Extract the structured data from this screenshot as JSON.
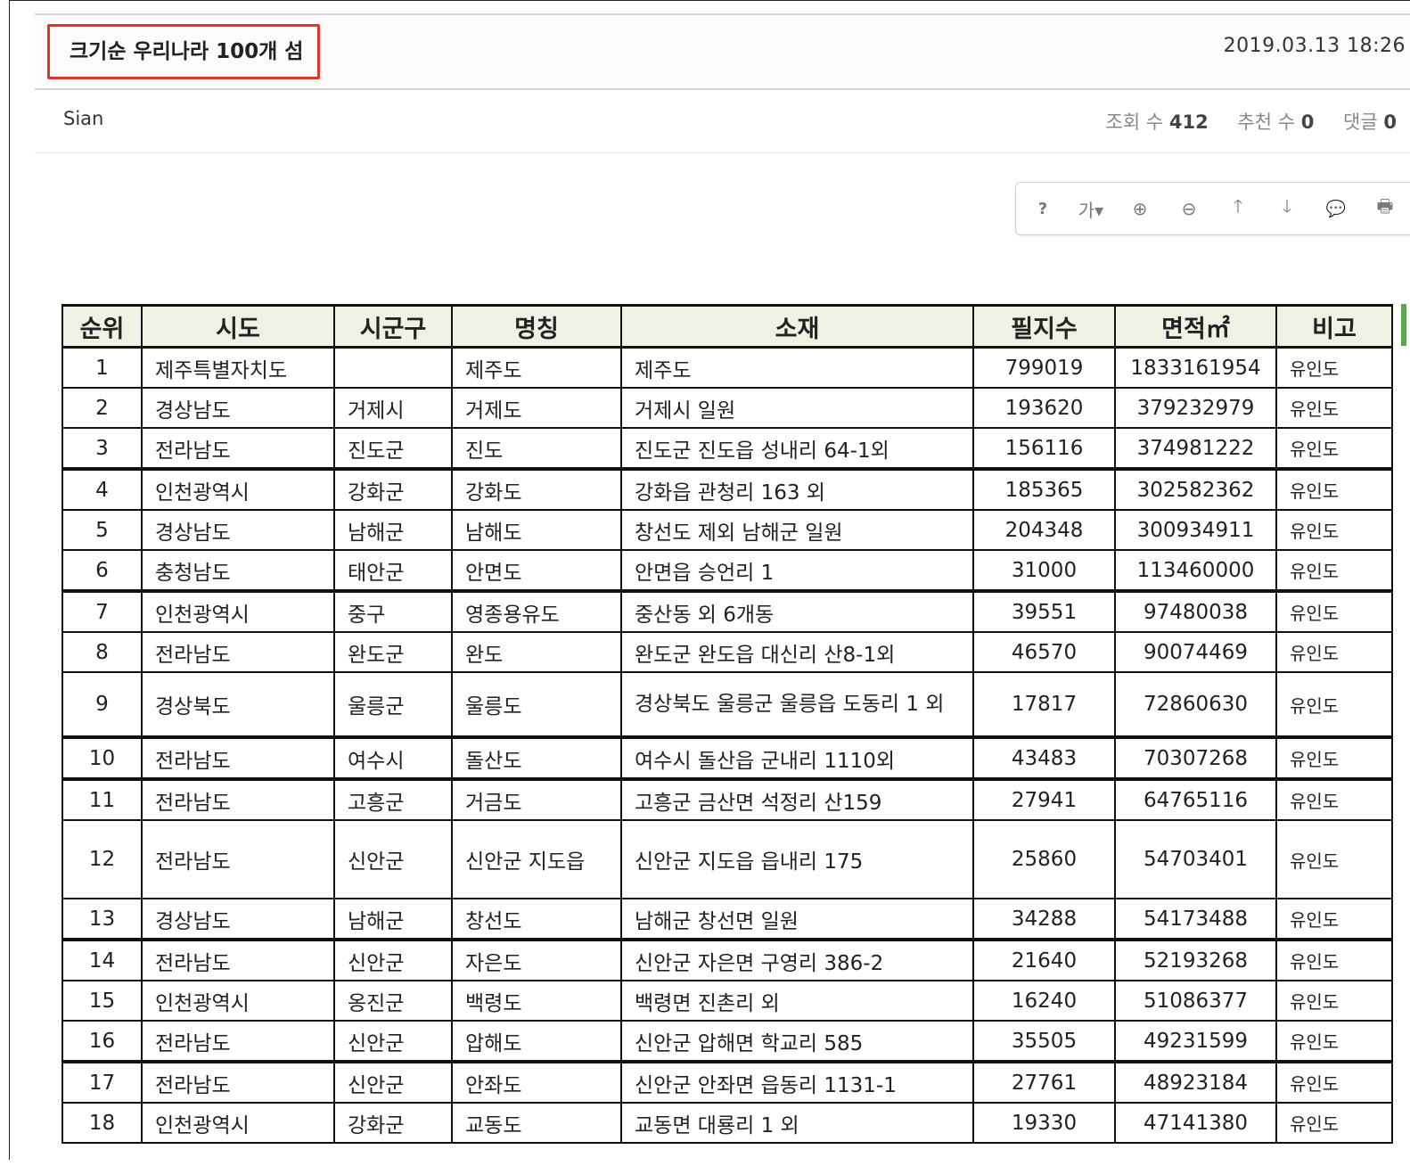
{
  "post": {
    "title": "크기순 우리나라 100개 섬",
    "date": "2019.03.13 18:26",
    "author": "Sian",
    "stats": [
      {
        "label": "조회 수",
        "value": "412"
      },
      {
        "label": "추천 수",
        "value": "0"
      },
      {
        "label": "댓글",
        "value": "0"
      }
    ]
  },
  "toolbar": {
    "buttons": [
      {
        "name": "help-icon",
        "glyph": "?"
      },
      {
        "name": "font-size-icon",
        "glyph": "가▾"
      },
      {
        "name": "zoom-in-icon",
        "glyph": "⊕"
      },
      {
        "name": "zoom-out-icon",
        "glyph": "⊖"
      },
      {
        "name": "arrow-up-icon",
        "glyph": "🡑"
      },
      {
        "name": "arrow-down-icon",
        "glyph": "🡓"
      },
      {
        "name": "comment-icon",
        "glyph": "💬"
      },
      {
        "name": "print-icon",
        "glyph": "🖶"
      }
    ]
  },
  "table": {
    "headers": [
      "순위",
      "시도",
      "시군구",
      "명칭",
      "소재",
      "필지수",
      "면적㎡",
      "비고"
    ],
    "rows": [
      [
        "1",
        "제주특별자치도",
        "",
        "제주도",
        "제주도",
        "799019",
        "1833161954",
        "유인도"
      ],
      [
        "2",
        "경상남도",
        "거제시",
        "거제도",
        "거제시 일원",
        "193620",
        "379232979",
        "유인도"
      ],
      [
        "3",
        "전라남도",
        "진도군",
        "진도",
        "진도군 진도읍 성내리 64-1외",
        "156116",
        "374981222",
        "유인도"
      ],
      [
        "4",
        "인천광역시",
        "강화군",
        "강화도",
        "강화읍 관청리 163 외",
        "185365",
        "302582362",
        "유인도"
      ],
      [
        "5",
        "경상남도",
        "남해군",
        "남해도",
        "창선도 제외 남해군 일원",
        "204348",
        "300934911",
        "유인도"
      ],
      [
        "6",
        "충청남도",
        "태안군",
        "안면도",
        "안면읍 승언리 1",
        "31000",
        "113460000",
        "유인도"
      ],
      [
        "7",
        "인천광역시",
        "중구",
        "영종용유도",
        "중산동 외 6개동",
        "39551",
        "97480038",
        "유인도"
      ],
      [
        "8",
        "전라남도",
        "완도군",
        "완도",
        "완도군 완도읍 대신리 산8-1외",
        "46570",
        "90074469",
        "유인도"
      ],
      [
        "9",
        "경상북도",
        "울릉군",
        "울릉도",
        "경상북도 울릉군 울릉읍 도동리 1 외",
        "17817",
        "72860630",
        "유인도"
      ],
      [
        "10",
        "전라남도",
        "여수시",
        "돌산도",
        "여수시 돌산읍 군내리 1110외",
        "43483",
        "70307268",
        "유인도"
      ],
      [
        "11",
        "전라남도",
        "고흥군",
        "거금도",
        "고흥군 금산면 석정리 산159",
        "27941",
        "64765116",
        "유인도"
      ],
      [
        "12",
        "전라남도",
        "신안군",
        "신안군 지도읍",
        "신안군 지도읍 읍내리 175",
        "25860",
        "54703401",
        "유인도"
      ],
      [
        "13",
        "경상남도",
        "남해군",
        "창선도",
        "남해군 창선면 일원",
        "34288",
        "54173488",
        "유인도"
      ],
      [
        "14",
        "전라남도",
        "신안군",
        "자은도",
        "신안군 자은면 구영리 386-2",
        "21640",
        "52193268",
        "유인도"
      ],
      [
        "15",
        "인천광역시",
        "옹진군",
        "백령도",
        "백령면 진촌리 외",
        "16240",
        "51086377",
        "유인도"
      ],
      [
        "16",
        "전라남도",
        "신안군",
        "압해도",
        "신안군 압해면 학교리 585",
        "35505",
        "49231599",
        "유인도"
      ],
      [
        "17",
        "전라남도",
        "신안군",
        "안좌도",
        "신안군 안좌면 읍동리 1131-1",
        "27761",
        "48923184",
        "유인도"
      ],
      [
        "18",
        "인천광역시",
        "강화군",
        "교동도",
        "교동면 대룡리 1 외",
        "19330",
        "47141380",
        "유인도"
      ]
    ]
  }
}
